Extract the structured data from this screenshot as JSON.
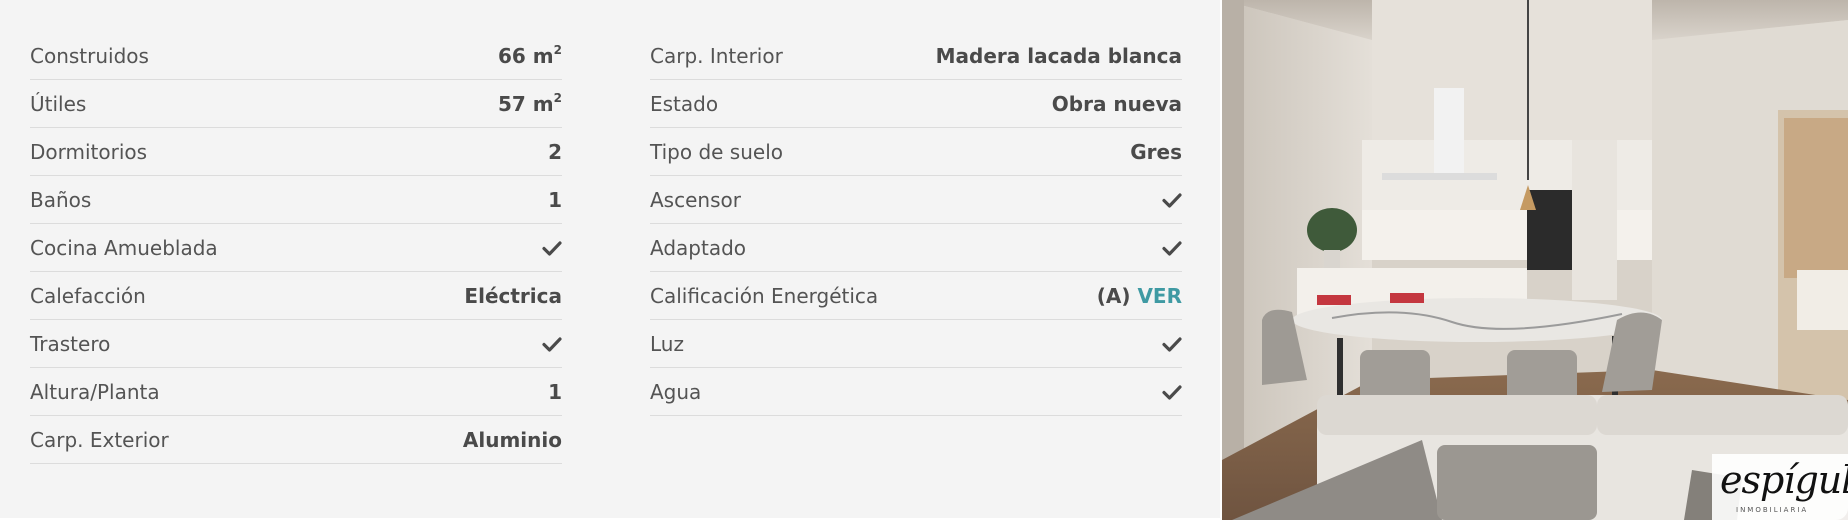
{
  "left_features": [
    {
      "label": "Construidos",
      "value": "66 m",
      "sup": "2"
    },
    {
      "label": "Útiles",
      "value": "57 m",
      "sup": "2"
    },
    {
      "label": "Dormitorios",
      "value": "2"
    },
    {
      "label": "Baños",
      "value": "1"
    },
    {
      "label": "Cocina Amueblada",
      "icon": "check-icon"
    },
    {
      "label": "Calefacción",
      "value": "Eléctrica"
    },
    {
      "label": "Trastero",
      "icon": "check-icon"
    },
    {
      "label": "Altura/Planta",
      "value": "1"
    },
    {
      "label": "Carp. Exterior",
      "value": "Aluminio"
    }
  ],
  "right_features": [
    {
      "label": "Carp. Interior",
      "value": "Madera lacada blanca"
    },
    {
      "label": "Estado",
      "value": "Obra nueva"
    },
    {
      "label": "Tipo de suelo",
      "value": "Gres"
    },
    {
      "label": "Ascensor",
      "icon": "check-icon"
    },
    {
      "label": "Adaptado",
      "icon": "check-icon"
    },
    {
      "label": "Calificación Energética",
      "value": "(A)",
      "link": "VER"
    },
    {
      "label": "Luz",
      "icon": "check-icon"
    },
    {
      "label": "Agua",
      "icon": "check-icon"
    }
  ],
  "photo": {
    "logo_name": "espígul",
    "logo_tagline": "INMOBILIARIA"
  },
  "colors": {
    "panel_bg": "#f4f4f4",
    "text": "#545454",
    "link": "#3f9aa3",
    "divider": "#dcdcdc"
  }
}
